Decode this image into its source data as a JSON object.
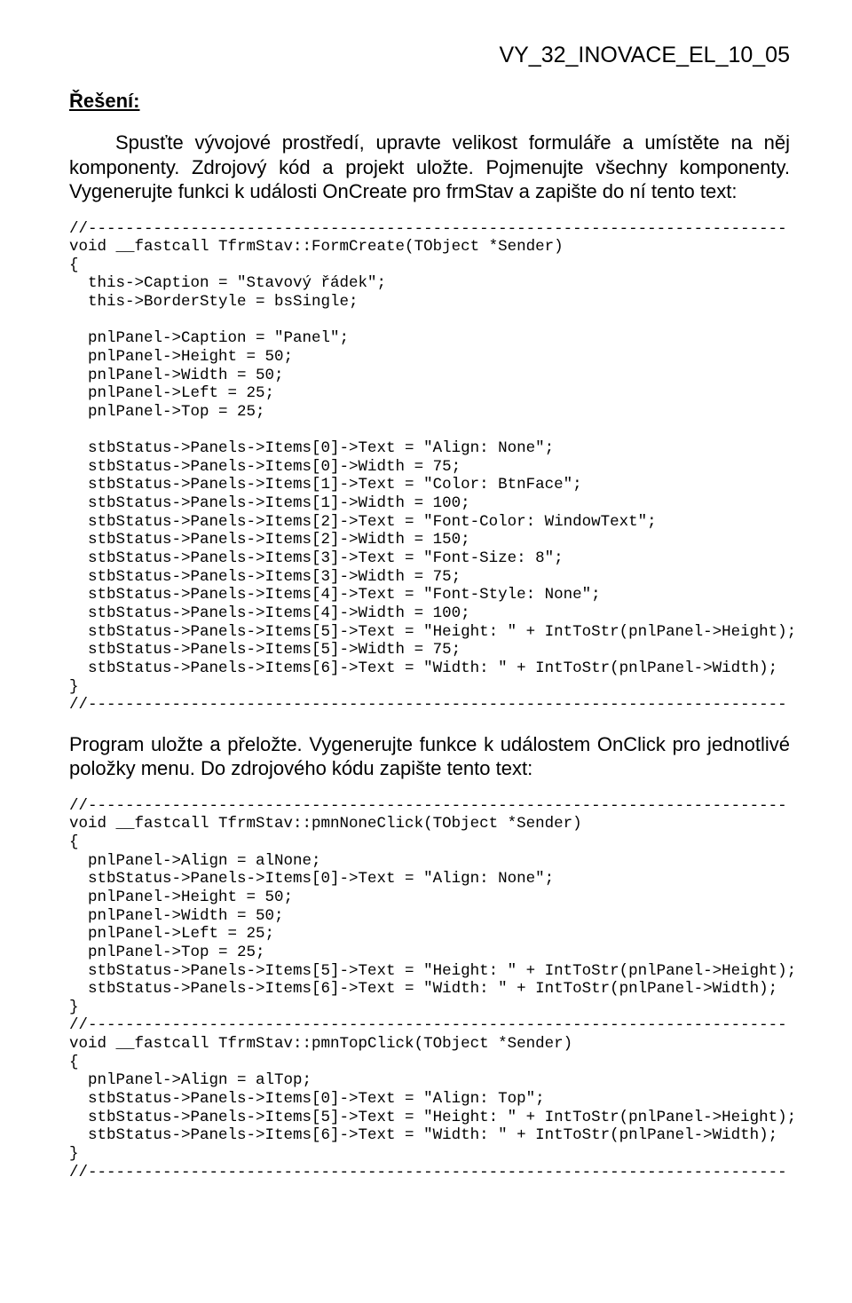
{
  "doc_id": "VY_32_INOVACE_EL_10_05",
  "heading": "Řešení:",
  "para1": "Spusťte vývojové prostředí, upravte velikost formuláře a umístěte na něj komponenty. Zdrojový kód a projekt uložte. Pojmenujte všechny komponenty. Vygenerujte funkci k události OnCreate pro frmStav a zapište do ní tento text:",
  "code1": "//---------------------------------------------------------------------------\nvoid __fastcall TfrmStav::FormCreate(TObject *Sender)\n{\n  this->Caption = \"Stavový řádek\";\n  this->BorderStyle = bsSingle;\n\n  pnlPanel->Caption = \"Panel\";\n  pnlPanel->Height = 50;\n  pnlPanel->Width = 50;\n  pnlPanel->Left = 25;\n  pnlPanel->Top = 25;\n\n  stbStatus->Panels->Items[0]->Text = \"Align: None\";\n  stbStatus->Panels->Items[0]->Width = 75;\n  stbStatus->Panels->Items[1]->Text = \"Color: BtnFace\";\n  stbStatus->Panels->Items[1]->Width = 100;\n  stbStatus->Panels->Items[2]->Text = \"Font-Color: WindowText\";\n  stbStatus->Panels->Items[2]->Width = 150;\n  stbStatus->Panels->Items[3]->Text = \"Font-Size: 8\";\n  stbStatus->Panels->Items[3]->Width = 75;\n  stbStatus->Panels->Items[4]->Text = \"Font-Style: None\";\n  stbStatus->Panels->Items[4]->Width = 100;\n  stbStatus->Panels->Items[5]->Text = \"Height: \" + IntToStr(pnlPanel->Height);\n  stbStatus->Panels->Items[5]->Width = 75;\n  stbStatus->Panels->Items[6]->Text = \"Width: \" + IntToStr(pnlPanel->Width);\n}\n//---------------------------------------------------------------------------",
  "para2": "Program uložte a přeložte. Vygenerujte funkce k událostem OnClick pro jednotlivé položky menu. Do zdrojového kódu zapište tento text:",
  "code2": "//---------------------------------------------------------------------------\nvoid __fastcall TfrmStav::pmnNoneClick(TObject *Sender)\n{\n  pnlPanel->Align = alNone;\n  stbStatus->Panels->Items[0]->Text = \"Align: None\";\n  pnlPanel->Height = 50;\n  pnlPanel->Width = 50;\n  pnlPanel->Left = 25;\n  pnlPanel->Top = 25;\n  stbStatus->Panels->Items[5]->Text = \"Height: \" + IntToStr(pnlPanel->Height);\n  stbStatus->Panels->Items[6]->Text = \"Width: \" + IntToStr(pnlPanel->Width);\n}\n//---------------------------------------------------------------------------\nvoid __fastcall TfrmStav::pmnTopClick(TObject *Sender)\n{\n  pnlPanel->Align = alTop;\n  stbStatus->Panels->Items[0]->Text = \"Align: Top\";\n  stbStatus->Panels->Items[5]->Text = \"Height: \" + IntToStr(pnlPanel->Height);\n  stbStatus->Panels->Items[6]->Text = \"Width: \" + IntToStr(pnlPanel->Width);\n}\n//---------------------------------------------------------------------------"
}
